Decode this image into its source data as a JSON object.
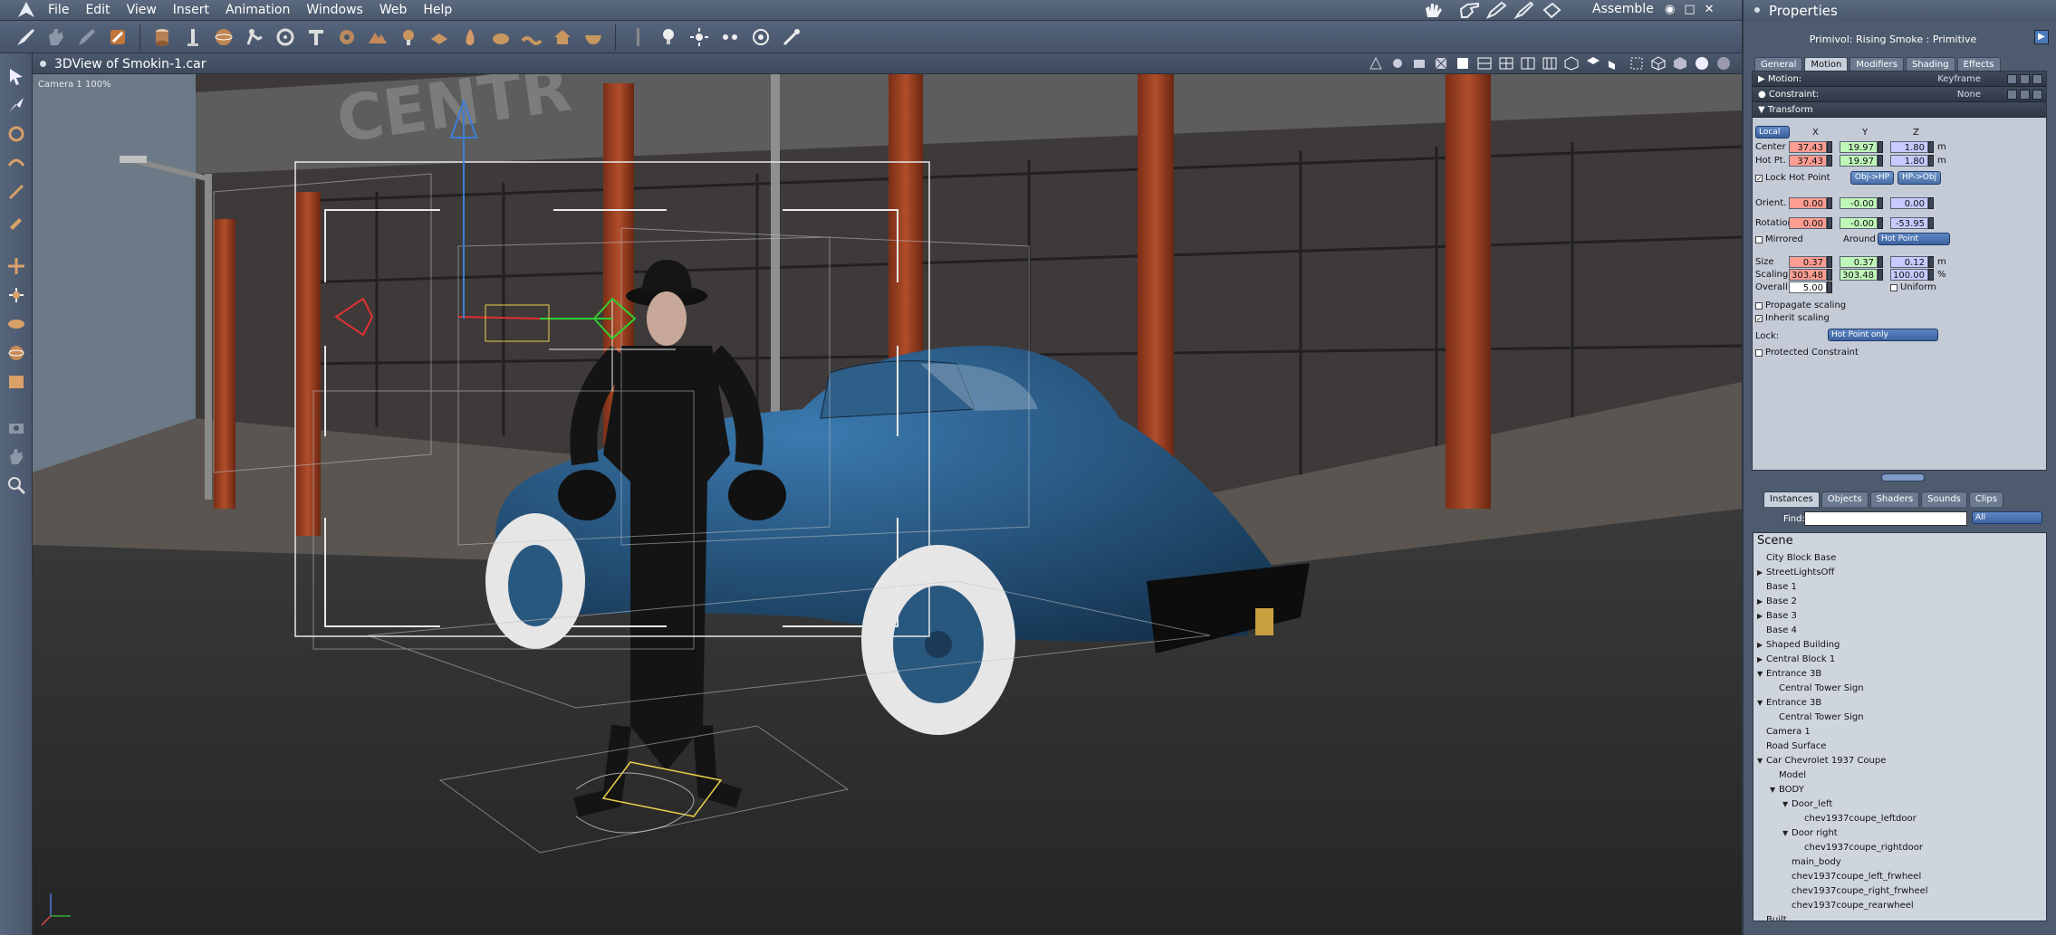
{
  "app": {
    "menu": [
      "File",
      "Edit",
      "View",
      "Insert",
      "Animation",
      "Windows",
      "Web",
      "Help"
    ],
    "room": "Assemble",
    "window_controls": [
      "◉",
      "□",
      "✕"
    ]
  },
  "viewport": {
    "title": "3DView of Smokin-1.car",
    "camera_label": "Camera 1 100%",
    "building_sign": "CENTR"
  },
  "properties": {
    "title": "Properties",
    "object": "Primivol: Rising Smoke : Primitive",
    "tabs": [
      "General",
      "Motion",
      "Modifiers",
      "Shading",
      "Effects"
    ],
    "active_tab": "Motion",
    "motion": {
      "label": "Motion:",
      "value": "Keyframe"
    },
    "constraint": {
      "label": "Constraint:",
      "value": "None"
    },
    "transform": {
      "label": "Transform",
      "space": "Local",
      "axes": [
        "X",
        "Y",
        "Z"
      ],
      "center": {
        "label": "Center",
        "x": "37.43",
        "y": "19.97",
        "z": "1.80",
        "unit": "m"
      },
      "hotpt": {
        "label": "Hot Pt.",
        "x": "37.43",
        "y": "19.97",
        "z": "1.80",
        "unit": "m"
      },
      "lock_hot_point": "Lock Hot Point",
      "obj_hp": "Obj->HP",
      "hp_obj": "HP->Obj",
      "orient": {
        "label": "Orient.",
        "x": "0.00",
        "y": "-0.00",
        "z": "0.00"
      },
      "rotation": {
        "label": "Rotation",
        "x": "0.00",
        "y": "-0.00",
        "z": "-53.95"
      },
      "mirrored": "Mirrored",
      "around": "Around",
      "around_value": "Hot Point",
      "size": {
        "label": "Size",
        "x": "0.37",
        "y": "0.37",
        "z": "0.12",
        "unit": "m"
      },
      "scaling": {
        "label": "Scaling",
        "x": "303.48",
        "y": "303.48",
        "z": "100.00",
        "unit": "%"
      },
      "overall": {
        "label": "Overall",
        "value": "5.00"
      },
      "uniform": "Uniform",
      "propagate": "Propagate scaling",
      "inherit": "Inherit scaling",
      "lock": "Lock:",
      "lock_value": "Hot Point only",
      "protected": "Protected Constraint"
    },
    "instance_tabs": [
      "Instances",
      "Objects",
      "Shaders",
      "Sounds",
      "Clips"
    ],
    "find_label": "Find:",
    "find_filter": "All",
    "scene": [
      {
        "label": "Scene",
        "indent": 0,
        "tri": ""
      },
      {
        "label": "City Block Base",
        "indent": 1,
        "tri": ""
      },
      {
        "label": "StreetLightsOff",
        "indent": 1,
        "tri": "▶"
      },
      {
        "label": "Base 1",
        "indent": 1,
        "tri": ""
      },
      {
        "label": "Base 2",
        "indent": 1,
        "tri": "▶"
      },
      {
        "label": "Base 3",
        "indent": 1,
        "tri": "▶"
      },
      {
        "label": "Base 4",
        "indent": 1,
        "tri": ""
      },
      {
        "label": "Shaped Building",
        "indent": 1,
        "tri": "▶"
      },
      {
        "label": "Central Block 1",
        "indent": 1,
        "tri": "▶"
      },
      {
        "label": "Entrance 3B",
        "indent": 1,
        "tri": "▼"
      },
      {
        "label": "Central Tower Sign",
        "indent": 2,
        "tri": ""
      },
      {
        "label": "Entrance 3B",
        "indent": 1,
        "tri": "▼"
      },
      {
        "label": "Central Tower Sign",
        "indent": 2,
        "tri": ""
      },
      {
        "label": "Camera 1",
        "indent": 1,
        "tri": ""
      },
      {
        "label": "Road Surface",
        "indent": 1,
        "tri": ""
      },
      {
        "label": "Car Chevrolet 1937 Coupe",
        "indent": 1,
        "tri": "▼"
      },
      {
        "label": "Model",
        "indent": 2,
        "tri": ""
      },
      {
        "label": "BODY",
        "indent": 2,
        "tri": "▼"
      },
      {
        "label": "Door_left",
        "indent": 3,
        "tri": "▼"
      },
      {
        "label": "chev1937coupe_leftdoor",
        "indent": 4,
        "tri": ""
      },
      {
        "label": "Door right",
        "indent": 3,
        "tri": "▼"
      },
      {
        "label": "chev1937coupe_rightdoor",
        "indent": 4,
        "tri": ""
      },
      {
        "label": "main_body",
        "indent": 3,
        "tri": ""
      },
      {
        "label": "chev1937coupe_left_frwheel",
        "indent": 3,
        "tri": ""
      },
      {
        "label": "chev1937coupe_right_frwheel",
        "indent": 3,
        "tri": ""
      },
      {
        "label": "chev1937coupe_rearwheel",
        "indent": 3,
        "tri": ""
      },
      {
        "label": "Built",
        "indent": 1,
        "tri": ""
      }
    ]
  }
}
